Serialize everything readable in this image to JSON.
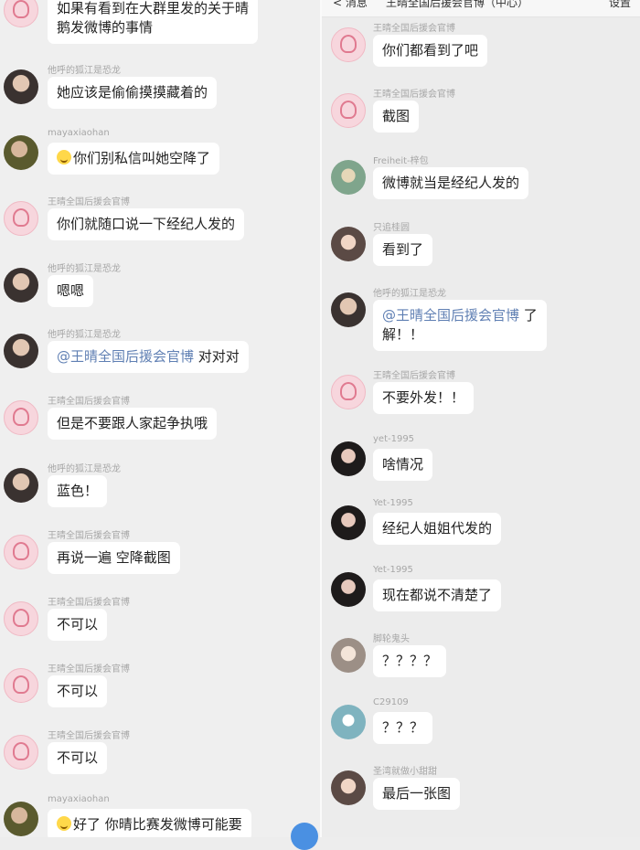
{
  "top_bar": {
    "back": "< 消息",
    "title": "王晴全国后援会官博（中心）",
    "more": "设置"
  },
  "left": [
    {
      "avatar": "official",
      "name": "",
      "text": [
        "如果有看到在大群里发的关于晴",
        "鹅发微博的事情"
      ]
    },
    {
      "avatar": "dark",
      "name": "他呼的狐江是恐龙",
      "text": [
        "她应该是偷偷摸摸藏着的"
      ]
    },
    {
      "avatar": "olive",
      "name": "mayaxiaohan",
      "emoji": "laugh-emoji",
      "text": [
        "你们别私信叫她空降了"
      ]
    },
    {
      "avatar": "official",
      "name": "王晴全国后援会官博",
      "text": [
        "你们就随口说一下经纪人发的"
      ]
    },
    {
      "avatar": "dark",
      "name": "他呼的狐江是恐龙",
      "text": [
        "嗯嗯"
      ]
    },
    {
      "avatar": "dark",
      "name": "他呼的狐江是恐龙",
      "mention": "@王晴全国后援会官博",
      "text": [
        " 对对对"
      ]
    },
    {
      "avatar": "official",
      "name": "王晴全国后援会官博",
      "text": [
        "但是不要跟人家起争执哦"
      ]
    },
    {
      "avatar": "dark",
      "name": "他呼的狐江是恐龙",
      "text": [
        "蓝色！"
      ]
    },
    {
      "avatar": "official",
      "name": "王晴全国后援会官博",
      "text": [
        "再说一遍 空降截图"
      ]
    },
    {
      "avatar": "official",
      "name": "王晴全国后援会官博",
      "text": [
        "不可以"
      ]
    },
    {
      "avatar": "official",
      "name": "王晴全国后援会官博",
      "text": [
        "不可以"
      ]
    },
    {
      "avatar": "official",
      "name": "王晴全国后援会官博",
      "text": [
        "不可以"
      ]
    },
    {
      "avatar": "olive",
      "name": "mayaxiaohan",
      "emoji": "laugh-emoji",
      "text": [
        "好了  你晴比赛发微博可能要"
      ]
    }
  ],
  "right": [
    {
      "avatar": "official",
      "name": "王晴全国后援会官博",
      "text": [
        "你们都看到了吧"
      ]
    },
    {
      "avatar": "official",
      "name": "王晴全国后援会官博",
      "text": [
        "截图"
      ]
    },
    {
      "avatar": "green",
      "name": "Freiheit-梓包",
      "text": [
        "微博就当是经纪人发的"
      ]
    },
    {
      "avatar": "girl",
      "name": "只追桂圆",
      "text": [
        "看到了"
      ]
    },
    {
      "avatar": "dark",
      "name": "他呼的狐江是恐龙",
      "mention": "@王晴全国后援会官博",
      "text": [
        " 了",
        "解！！"
      ]
    },
    {
      "avatar": "official",
      "name": "王晴全国后援会官博",
      "text": [
        "不要外发！！"
      ]
    },
    {
      "avatar": "mask",
      "name": "yet-1995",
      "text": [
        "啥情况"
      ]
    },
    {
      "avatar": "mask",
      "name": "Yet-1995",
      "text": [
        "经纪人姐姐代发的"
      ]
    },
    {
      "avatar": "mask",
      "name": "Yet-1995",
      "text": [
        "现在都说不清楚了"
      ]
    },
    {
      "avatar": "light",
      "name": "脚轮鬼头",
      "text": [
        "？？？？"
      ]
    },
    {
      "avatar": "teal",
      "name": "C29109",
      "text": [
        "？？？"
      ]
    },
    {
      "avatar": "girl",
      "name": "圣湾就做小甜甜",
      "text": [
        "最后一张图"
      ]
    }
  ]
}
